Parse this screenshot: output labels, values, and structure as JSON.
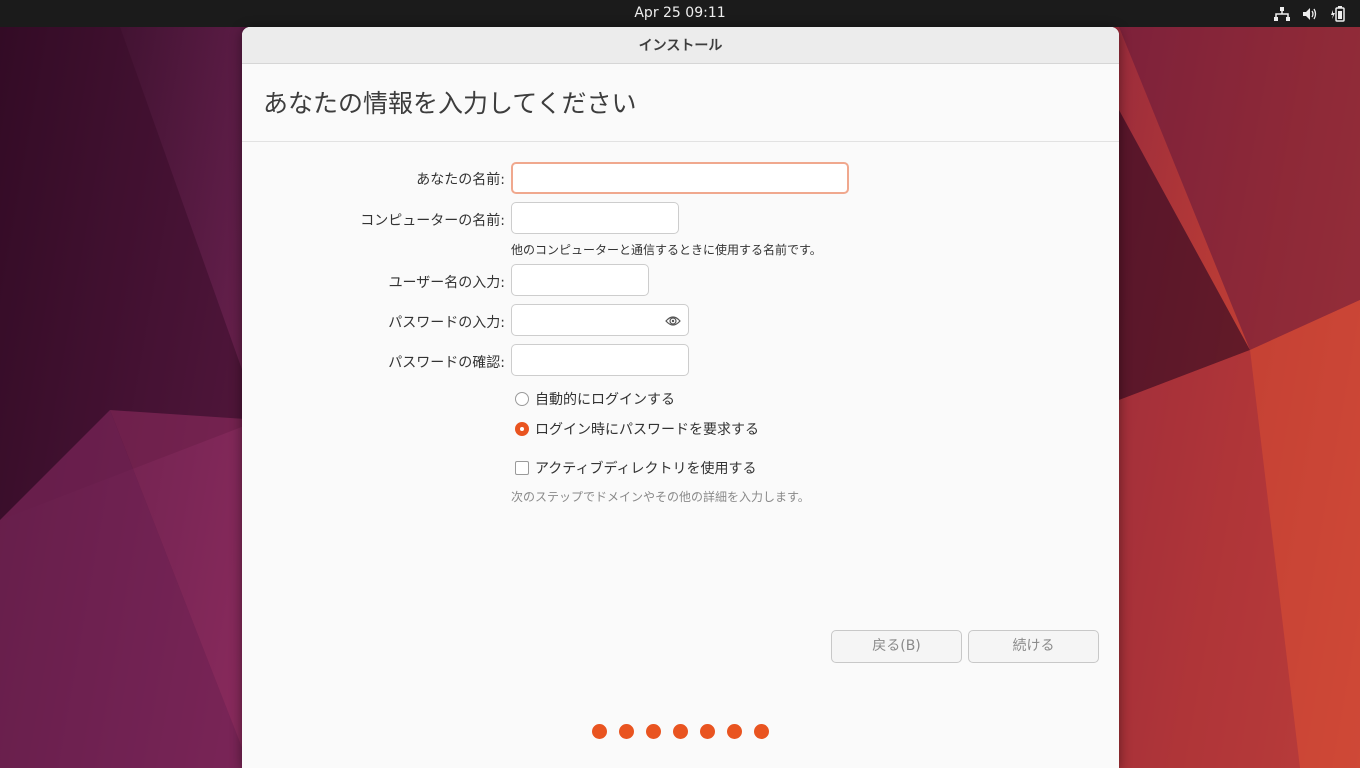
{
  "topbar": {
    "clock": "Apr 25  09:11"
  },
  "tray_icons": [
    "network-icon",
    "volume-icon",
    "battery-icon"
  ],
  "window": {
    "title": "インストール"
  },
  "page": {
    "heading": "あなたの情報を入力してください"
  },
  "form": {
    "name_label": "あなたの名前:",
    "name_value": "",
    "computer_label": "コンピューターの名前:",
    "computer_value": "",
    "computer_hint": "他のコンピューターと通信するときに使用する名前です。",
    "username_label": "ユーザー名の入力:",
    "username_value": "",
    "password_label": "パスワードの入力:",
    "password_value": "",
    "confirm_label": "パスワードの確認:",
    "confirm_value": "",
    "auto_login_label": "自動的にログインする",
    "require_password_label": "ログイン時にパスワードを要求する",
    "selected_login_option": "require_password",
    "active_directory_label": "アクティブディレクトリを使用する",
    "active_directory_checked": false,
    "active_directory_hint": "次のステップでドメインやその他の詳細を入力します。"
  },
  "buttons": {
    "back": "戻る(B)",
    "continue": "続ける"
  },
  "progress": {
    "total_steps": 7
  },
  "colors": {
    "accent": "#e95420",
    "focus_border": "#f0a88e"
  }
}
